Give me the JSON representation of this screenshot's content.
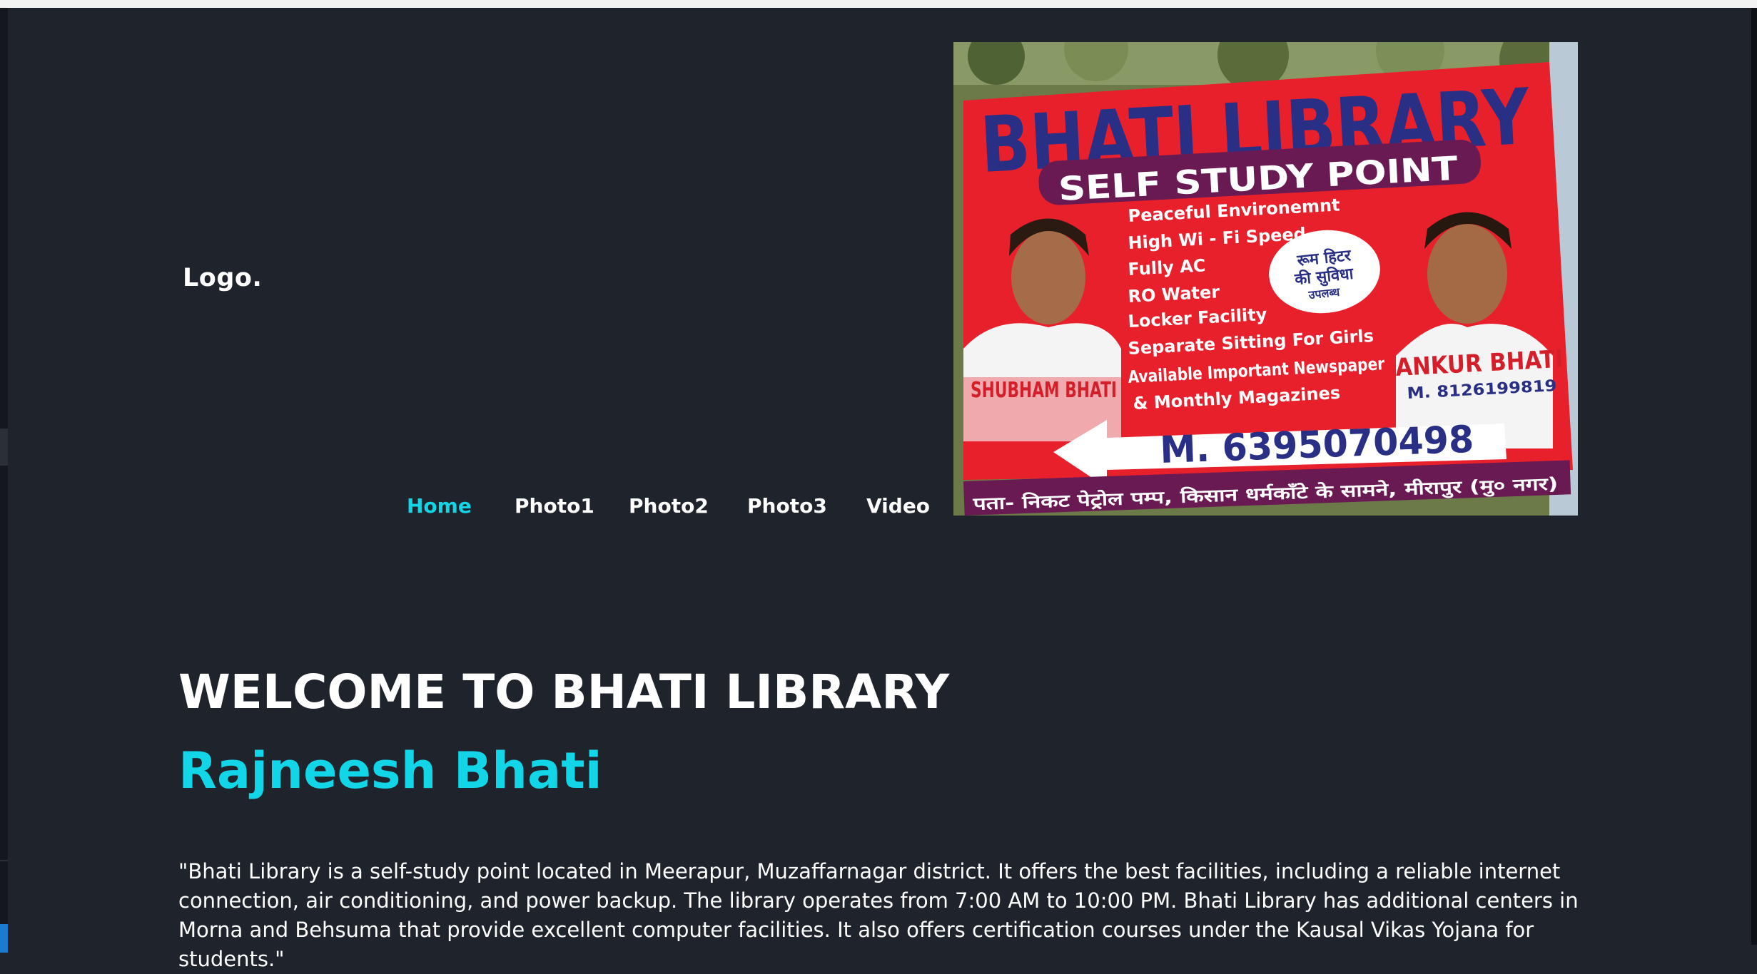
{
  "header": {
    "logo": "Logo.",
    "nav": [
      {
        "label": "Home",
        "active": true
      },
      {
        "label": "Photo1",
        "active": false
      },
      {
        "label": "Photo2",
        "active": false
      },
      {
        "label": "Photo3",
        "active": false
      },
      {
        "label": "Video",
        "active": false
      }
    ]
  },
  "banner": {
    "title": "BHATI LIBRARY",
    "subtitle": "SELF STUDY POINT",
    "features": [
      "Peaceful Environemnt",
      "High Wi - Fi Speed",
      "Fully AC",
      "RO Water",
      "Locker Facility",
      "Separate Sitting For Girls",
      "Available Important Newspaper",
      "& Monthly Magazines"
    ],
    "badge_lines": [
      "रूम हिटर",
      "की सुविधा",
      "उपलब्ध"
    ],
    "person_left": "SHUBHAM BHATI",
    "person_right": "ANKUR BHATI",
    "person_right_phone": "M. 8126199819",
    "phone": "M. 6395070498",
    "address": "पता- निकट पेट्रोल पम्प, किसान धर्मकाँटे के सामने, मीरापुर (मु० नगर)"
  },
  "main": {
    "heading": "WELCOME TO BHATI LIBRARY",
    "name": "Rajneesh Bhati",
    "description": "\"Bhati Library is a self-study point located in Meerapur, Muzaffarnagar district. It offers the best facilities, including a reliable internet connection, air conditioning, and power backup. The library operates from 7:00 AM to 10:00 PM. Bhati Library has additional centers in Morna and Behsuma that provide excellent computer facilities. It also offers certification courses under the Kausal Vikas Yojana for students.\""
  },
  "colors": {
    "background": "#1f232c",
    "accent": "#12d6e8",
    "text": "#ffffff",
    "banner_red": "#e8202c",
    "banner_blue": "#2a2f86"
  }
}
